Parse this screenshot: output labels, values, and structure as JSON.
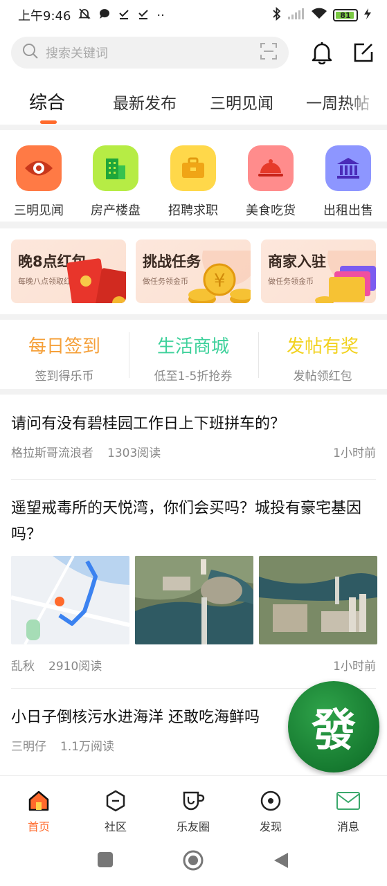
{
  "status_bar": {
    "time": "上午9:46",
    "extra": "··",
    "battery": "81",
    "battery_level": 0.81
  },
  "search": {
    "placeholder": "搜索关键词"
  },
  "tabs": [
    {
      "label": "综合",
      "active": true
    },
    {
      "label": "最新发布",
      "active": false
    },
    {
      "label": "三明见闻",
      "active": false
    },
    {
      "label": "一周热帖",
      "active": false
    }
  ],
  "categories": [
    {
      "label": "三明见闻",
      "icon": "eye-icon",
      "color": "#ff7a45"
    },
    {
      "label": "房产楼盘",
      "icon": "building-icon",
      "color": "#b6ec45"
    },
    {
      "label": "招聘求职",
      "icon": "briefcase-icon",
      "color": "#ffd84a"
    },
    {
      "label": "美食吃货",
      "icon": "food-cloche-icon",
      "color": "#ff8c8c"
    },
    {
      "label": "出租出售",
      "icon": "bank-icon",
      "color": "#8d96ff"
    }
  ],
  "promos": [
    {
      "title": "晚8点红包",
      "subtitle": "每晚八点领取红包"
    },
    {
      "title": "挑战任务",
      "subtitle": "做任务领金币"
    },
    {
      "title": "商家入驻",
      "subtitle": "做任务领金币"
    }
  ],
  "quick_actions": [
    {
      "title": "每日签到",
      "subtitle": "签到得乐币",
      "color": "#f5a03a"
    },
    {
      "title": "生活商城",
      "subtitle": "低至1-5折抢券",
      "color": "#3ed19b"
    },
    {
      "title": "发帖有奖",
      "subtitle": "发帖领红包",
      "color": "#f2d21e"
    }
  ],
  "posts": [
    {
      "title": "请问有没有碧桂园工作日上下班拼车的？",
      "author": "格拉斯哥流浪者",
      "reads": "1303阅读",
      "time": "1小时前"
    },
    {
      "title": "遥望戒毒所的天悦湾，你们会买吗？城投有豪宅基因吗？",
      "author": "乱秋",
      "reads": "2910阅读",
      "time": "1小时前"
    },
    {
      "title": "小日子倒核污水进海洋 还敢吃海鲜吗",
      "author": "三明仔",
      "reads": "1.1万阅读",
      "time": ""
    }
  ],
  "fab": {
    "label": "發"
  },
  "bottom_nav": [
    {
      "label": "首页",
      "icon": "home-icon",
      "active": true
    },
    {
      "label": "社区",
      "icon": "community-hexagon-icon",
      "active": false
    },
    {
      "label": "乐友圈",
      "icon": "cup-icon",
      "active": false
    },
    {
      "label": "发现",
      "icon": "discover-icon",
      "active": false
    },
    {
      "label": "消息",
      "icon": "mail-icon",
      "active": false
    }
  ],
  "colors": {
    "accent": "#ff6a2c"
  }
}
